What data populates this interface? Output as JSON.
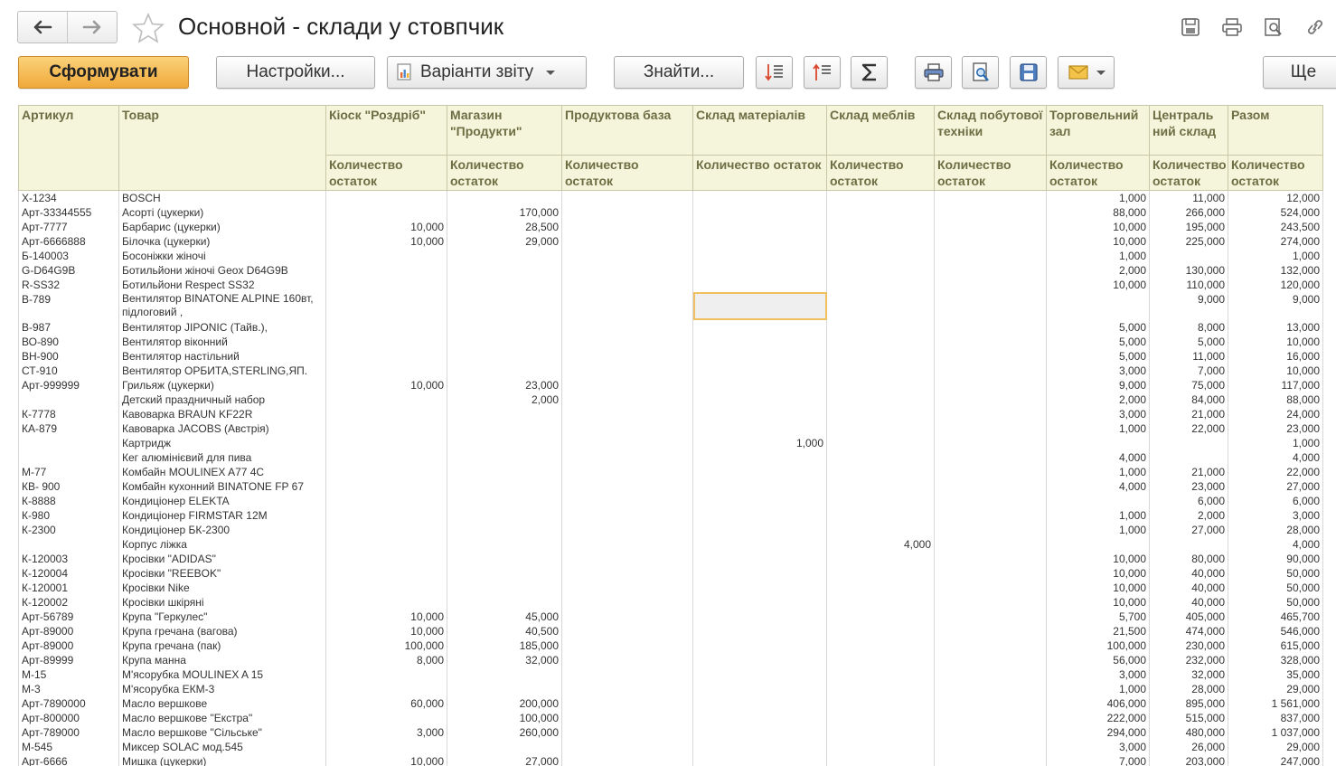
{
  "window": {
    "title": "Основной - склади у стовпчик"
  },
  "icons": {
    "back": "arrow-left-icon",
    "forward": "arrow-right-icon",
    "favorite": "star-icon",
    "save": "floppy-icon",
    "print": "printer-icon",
    "preview": "preview-icon",
    "link": "link-icon"
  },
  "colors": {
    "primary_button": "#f0a93a",
    "header_bg": "#f5f5dc",
    "header_text": "#6e6e44",
    "selection": "#f0c060"
  },
  "toolbar": {
    "generate": "Сформувати",
    "settings": "Настройки...",
    "variants": "Варіанти звіту",
    "find": "Знайти...",
    "more": "Ще"
  },
  "table": {
    "headers": [
      "Артикул",
      "Товар",
      "Кіоск \"Роздріб\"",
      "Магазин \"Продукти\"",
      "Продуктова база",
      "Склад матеріалів",
      "Склад меблів",
      "Склад побутової техніки",
      "Торговельний зал",
      "Централь ний склад",
      "Разом"
    ],
    "subheader": "Количество остаток",
    "rows": [
      [
        "X-1234",
        "BOSCH",
        "",
        "",
        "",
        "",
        "",
        "",
        "1,000",
        "11,000",
        "12,000"
      ],
      [
        "Арт-33344555",
        "Асорті (цукерки)",
        "",
        "170,000",
        "",
        "",
        "",
        "",
        "88,000",
        "266,000",
        "524,000"
      ],
      [
        "Арт-7777",
        "Барбарис (цукерки)",
        "10,000",
        "28,500",
        "",
        "",
        "",
        "",
        "10,000",
        "195,000",
        "243,500"
      ],
      [
        "Арт-6666888",
        "Білочка (цукерки)",
        "10,000",
        "29,000",
        "",
        "",
        "",
        "",
        "10,000",
        "225,000",
        "274,000"
      ],
      [
        "Б-140003",
        "Босоніжки жіночі",
        "",
        "",
        "",
        "",
        "",
        "",
        "1,000",
        "",
        "1,000"
      ],
      [
        "G-D64G9B",
        "Ботильйони  жіночі Geox D64G9B",
        "",
        "",
        "",
        "",
        "",
        "",
        "2,000",
        "130,000",
        "132,000"
      ],
      [
        "R-SS32",
        "Ботильйони Respect SS32",
        "",
        "",
        "",
        "",
        "",
        "",
        "10,000",
        "110,000",
        "120,000"
      ],
      [
        "В-789",
        "Вентилятор BINATONE ALPINE 160вт, підлоговий ,",
        "",
        "",
        "",
        "",
        "",
        "",
        "",
        "9,000",
        "9,000"
      ],
      [
        "В-987",
        "Вентилятор JIPONIC (Тайв.),",
        "",
        "",
        "",
        "",
        "",
        "",
        "5,000",
        "8,000",
        "13,000"
      ],
      [
        "ВО-890",
        "Вентилятор віконний",
        "",
        "",
        "",
        "",
        "",
        "",
        "5,000",
        "5,000",
        "10,000"
      ],
      [
        "ВН-900",
        "Вентилятор настільний",
        "",
        "",
        "",
        "",
        "",
        "",
        "5,000",
        "11,000",
        "16,000"
      ],
      [
        "СТ-910",
        "Вентилятор ОРБИТА,STERLING,ЯП.",
        "",
        "",
        "",
        "",
        "",
        "",
        "3,000",
        "7,000",
        "10,000"
      ],
      [
        "Арт-999999",
        "Грильяж (цукерки)",
        "10,000",
        "23,000",
        "",
        "",
        "",
        "",
        "9,000",
        "75,000",
        "117,000"
      ],
      [
        "",
        "Детский праздничный набор",
        "",
        "2,000",
        "",
        "",
        "",
        "",
        "2,000",
        "84,000",
        "88,000"
      ],
      [
        "К-7778",
        "Кавоварка BRAUN KF22R",
        "",
        "",
        "",
        "",
        "",
        "",
        "3,000",
        "21,000",
        "24,000"
      ],
      [
        "КА-879",
        "Кавоварка JACOBS (Австрія)",
        "",
        "",
        "",
        "",
        "",
        "",
        "1,000",
        "22,000",
        "23,000"
      ],
      [
        "",
        "Картридж",
        "",
        "",
        "",
        "1,000",
        "",
        "",
        "",
        "",
        "1,000"
      ],
      [
        "",
        "Кег алюмінієвий для пива",
        "",
        "",
        "",
        "",
        "",
        "",
        "4,000",
        "",
        "4,000"
      ],
      [
        "М-77",
        "Комбайн MOULINEX A77 4C",
        "",
        "",
        "",
        "",
        "",
        "",
        "1,000",
        "21,000",
        "22,000"
      ],
      [
        "КВ- 900",
        "Комбайн кухонний BINATONE FP 67",
        "",
        "",
        "",
        "",
        "",
        "",
        "4,000",
        "23,000",
        "27,000"
      ],
      [
        "К-8888",
        "Кондиціонер ELEKTA",
        "",
        "",
        "",
        "",
        "",
        "",
        "",
        "6,000",
        "6,000"
      ],
      [
        "К-980",
        "Кондиціонер FIRMSTAR 12M",
        "",
        "",
        "",
        "",
        "",
        "",
        "1,000",
        "2,000",
        "3,000"
      ],
      [
        "К-2300",
        "Кондиціонер БК-2300",
        "",
        "",
        "",
        "",
        "",
        "",
        "1,000",
        "27,000",
        "28,000"
      ],
      [
        "",
        "Корпус ліжка",
        "",
        "",
        "",
        "",
        "4,000",
        "",
        "",
        "",
        "4,000"
      ],
      [
        "К-120003",
        "Кросівки \"ADIDAS\"",
        "",
        "",
        "",
        "",
        "",
        "",
        "10,000",
        "80,000",
        "90,000"
      ],
      [
        "К-120004",
        "Кросівки \"REEBOK\"",
        "",
        "",
        "",
        "",
        "",
        "",
        "10,000",
        "40,000",
        "50,000"
      ],
      [
        "К-120001",
        "Кросівки Nike",
        "",
        "",
        "",
        "",
        "",
        "",
        "10,000",
        "40,000",
        "50,000"
      ],
      [
        "К-120002",
        "Кросівки шкіряні",
        "",
        "",
        "",
        "",
        "",
        "",
        "10,000",
        "40,000",
        "50,000"
      ],
      [
        "Арт-56789",
        "Крупа \"Геркулес\"",
        "10,000",
        "45,000",
        "",
        "",
        "",
        "",
        "5,700",
        "405,000",
        "465,700"
      ],
      [
        "Арт-89000",
        "Крупа гречана (вагова)",
        "10,000",
        "40,500",
        "",
        "",
        "",
        "",
        "21,500",
        "474,000",
        "546,000"
      ],
      [
        "Арт-89000",
        "Крупа гречана (пак)",
        "100,000",
        "185,000",
        "",
        "",
        "",
        "",
        "100,000",
        "230,000",
        "615,000"
      ],
      [
        "Арт-89999",
        "Крупа манна",
        "8,000",
        "32,000",
        "",
        "",
        "",
        "",
        "56,000",
        "232,000",
        "328,000"
      ],
      [
        "М-15",
        "М'ясорубка MOULINEX A 15",
        "",
        "",
        "",
        "",
        "",
        "",
        "3,000",
        "32,000",
        "35,000"
      ],
      [
        "М-3",
        "М'ясорубка ЕКМ-3",
        "",
        "",
        "",
        "",
        "",
        "",
        "1,000",
        "28,000",
        "29,000"
      ],
      [
        "Арт-7890000",
        "Масло вершкове",
        "60,000",
        "200,000",
        "",
        "",
        "",
        "",
        "406,000",
        "895,000",
        "1 561,000"
      ],
      [
        "Арт-800000",
        "Масло вершкове \"Екстра\"",
        "",
        "100,000",
        "",
        "",
        "",
        "",
        "222,000",
        "515,000",
        "837,000"
      ],
      [
        "Арт-789000",
        "Масло вершкове \"Сільське\"",
        "3,000",
        "260,000",
        "",
        "",
        "",
        "",
        "294,000",
        "480,000",
        "1 037,000"
      ],
      [
        "М-545",
        "Миксер SOLAC мод.545",
        "",
        "",
        "",
        "",
        "",
        "",
        "3,000",
        "26,000",
        "29,000"
      ],
      [
        "Арт-6666",
        "Мишка (цукерки)",
        "10,000",
        "27,000",
        "",
        "",
        "",
        "",
        "7,000",
        "203,000",
        "247,000"
      ]
    ]
  }
}
